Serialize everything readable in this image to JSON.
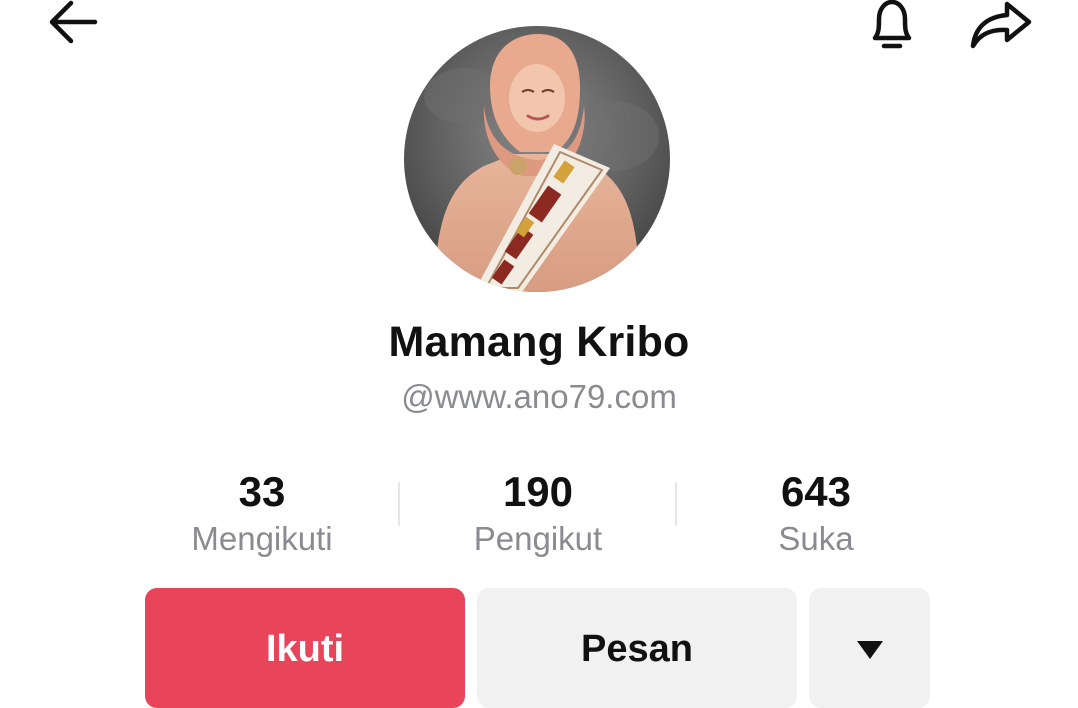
{
  "header": {
    "back_icon": "arrow-left-icon",
    "bell_icon": "bell-icon",
    "share_icon": "share-arrow-icon"
  },
  "profile": {
    "display_name": "Mamang Kribo",
    "username": "@www.ano79.com"
  },
  "stats": [
    {
      "value": "33",
      "label": "Mengikuti"
    },
    {
      "value": "190",
      "label": "Pengikut"
    },
    {
      "value": "643",
      "label": "Suka"
    }
  ],
  "actions": {
    "follow_label": "Ikuti",
    "message_label": "Pesan",
    "more_icon": "caret-down-icon"
  },
  "colors": {
    "follow_button": "#e8445a",
    "secondary_button": "#f1f1f2",
    "muted_text": "#8a8b91"
  }
}
